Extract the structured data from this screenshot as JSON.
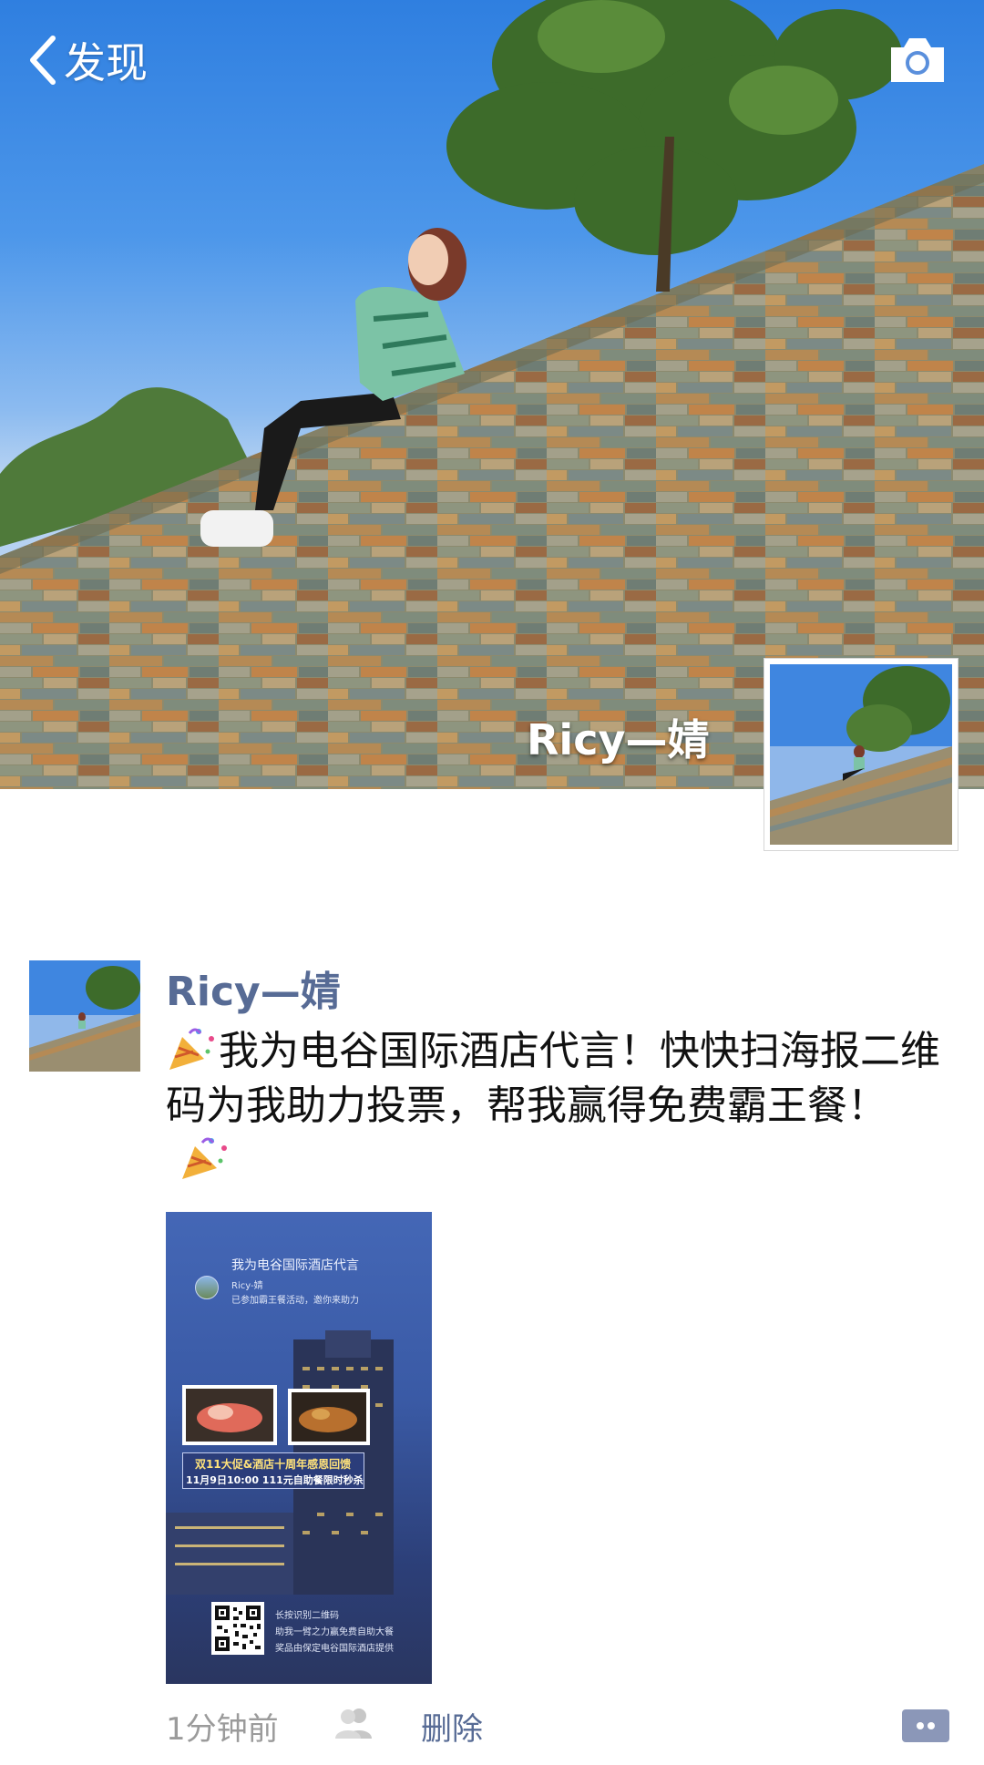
{
  "nav": {
    "back_label": "发现",
    "back_icon": "chevron-left-icon",
    "camera_icon": "camera-icon"
  },
  "profile": {
    "cover_name": "Ricy—婧",
    "avatar_icon": "profile-avatar"
  },
  "post": {
    "author": "Ricy—婧",
    "text": "我为电谷国际酒店代言！快快扫海报二维码为我助力投票，帮我赢得免费霸王餐！",
    "leading_emoji": "party-popper-icon",
    "trailing_emoji": "party-popper-icon",
    "poster": {
      "title": "我为电谷国际酒店代言",
      "user": "Ricy-婧",
      "subtitle": "已参加霸王餐活动，邀你来助力",
      "promo_line1": "双11大促&酒店十周年感恩回馈",
      "promo_line2": "11月9日10:00  111元自助餐限时秒杀",
      "qr_line1": "长按识别二维码",
      "qr_line2": "助我一臂之力赢免费自助大餐",
      "qr_line3": "奖品由保定电谷国际酒店提供"
    },
    "time": "1分钟前",
    "delete_label": "删除",
    "privacy_icon": "friends-icon",
    "comment_icon": "comment-icon"
  },
  "colors": {
    "link": "#576b95",
    "meta_gray": "#9b9b9b"
  }
}
